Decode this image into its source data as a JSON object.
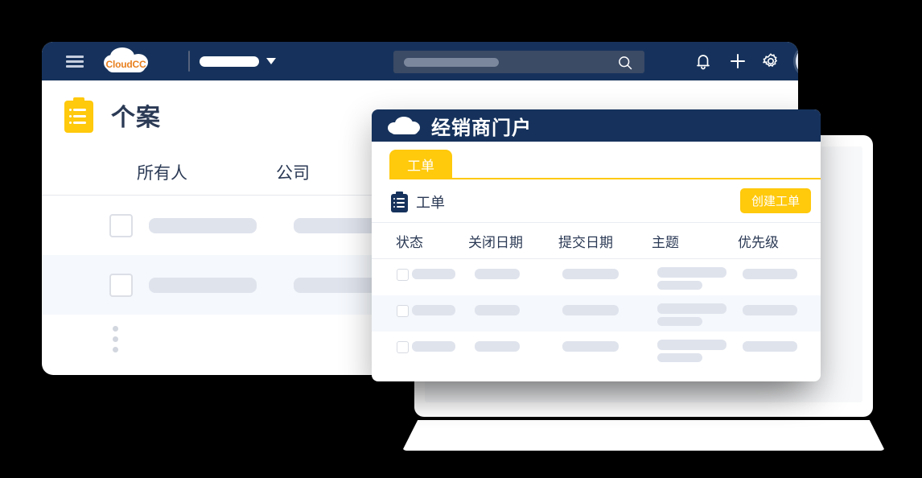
{
  "app_window": {
    "topbar": {
      "menu_icon": "hamburger-icon",
      "brand": "CloudCC",
      "app_selector_caret": "chevron-down-icon",
      "search": {
        "placeholder": "",
        "icon": "search-icon"
      },
      "icons": [
        {
          "name": "notification-icon",
          "label": "bell"
        },
        {
          "name": "add-icon",
          "label": "plus"
        },
        {
          "name": "settings-icon",
          "label": "gear"
        },
        {
          "name": "avatar",
          "label": "user-avatar"
        }
      ]
    },
    "page": {
      "icon": "clipboard-icon",
      "title": "个案"
    },
    "table": {
      "columns": [
        "所有人",
        "公司"
      ],
      "rows": [
        {
          "checked": false,
          "cells": [
            "",
            ""
          ]
        },
        {
          "checked": false,
          "cells": [
            "",
            ""
          ]
        }
      ],
      "overflow_menu": "more-vertical-icon"
    }
  },
  "portal_modal": {
    "header": {
      "icon": "cloud-icon",
      "title": "经销商门户"
    },
    "tabs": [
      {
        "label": "工单",
        "active": true
      }
    ],
    "section": {
      "icon": "clipboard-icon",
      "label": "工单",
      "create_button": "创建工单"
    },
    "table": {
      "columns": [
        "状态",
        "关闭日期",
        "提交日期",
        "主题",
        "优先级"
      ],
      "rows": [
        {
          "checked": false,
          "alt": false
        },
        {
          "checked": false,
          "alt": true
        },
        {
          "checked": false,
          "alt": false
        }
      ]
    }
  },
  "colors": {
    "navy": "#16325c",
    "yellow": "#ffc90c",
    "brand_orange": "#e8801f",
    "skeleton": "#dfe3ec",
    "row_alt": "#f5f8fc",
    "text_dark": "#2b3a55",
    "background": "#000000"
  }
}
